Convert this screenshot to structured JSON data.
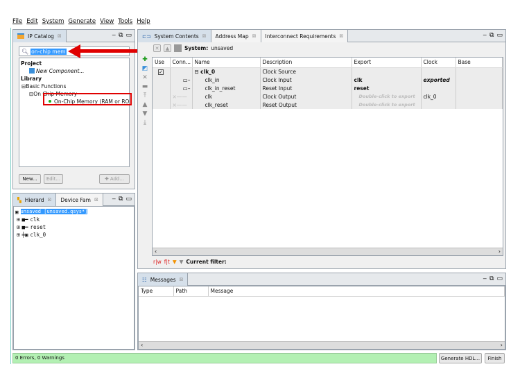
{
  "menu": [
    "File",
    "Edit",
    "System",
    "Generate",
    "View",
    "Tools",
    "Help"
  ],
  "ip_catalog": {
    "tab": "IP Catalog",
    "search_value": "on-chip mem",
    "project_label": "Project",
    "new_component": "New Component...",
    "library_label": "Library",
    "basic_functions": "Basic Functions",
    "on_chip_memory": "On Chip Memory",
    "highlighted_item": "On-Chip Memory (RAM or ROM)",
    "buttons": {
      "new": "New...",
      "edit": "Edit...",
      "add": "Add..."
    }
  },
  "hierarchy": {
    "tabs": [
      "Hierard",
      "Device Fam"
    ],
    "root": "unsaved [unsaved.qsys*]",
    "items": [
      "clk",
      "reset",
      "clk_0"
    ]
  },
  "system": {
    "tabs": [
      "System Contents",
      "Address Map",
      "Interconnect Requirements"
    ],
    "system_label": "System:",
    "system_name": "unsaved",
    "columns": [
      "Use",
      "Conn...",
      "Name",
      "Description",
      "Export",
      "Clock",
      "Base"
    ],
    "rows": [
      {
        "name": "clk_0",
        "description": "Clock Source",
        "export": "",
        "clock": ""
      },
      {
        "name": "clk_in",
        "description": "Clock Input",
        "export": "clk",
        "clock": "exported"
      },
      {
        "name": "clk_in_reset",
        "description": "Reset Input",
        "export": "reset",
        "clock": ""
      },
      {
        "name": "clk",
        "description": "Clock Output",
        "export": "Double-click to export",
        "clock": "clk_0"
      },
      {
        "name": "clk_reset",
        "description": "Reset Output",
        "export": "Double-click to export",
        "clock": ""
      }
    ],
    "filter_label": "Current filter:"
  },
  "messages": {
    "tab": "Messages",
    "columns": [
      "Type",
      "Path",
      "Message"
    ]
  },
  "status": {
    "text": "0 Errors, 0 Warnings",
    "generate": "Generate HDL...",
    "finish": "Finish"
  },
  "colors": {
    "status_green": "#b3f0b3",
    "highlight_red": "#e00000",
    "selection_blue": "#3399ff"
  }
}
